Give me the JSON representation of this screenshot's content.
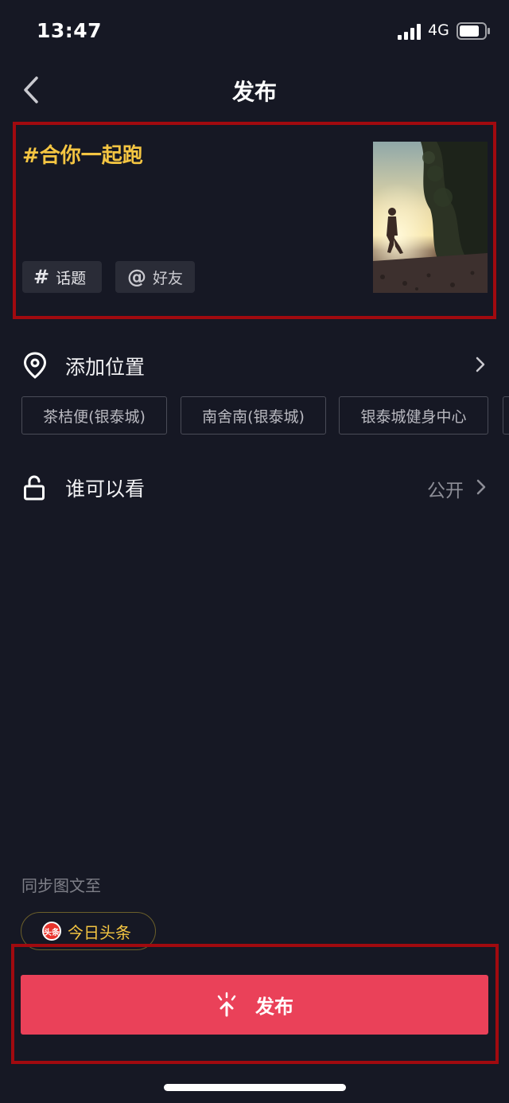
{
  "status_bar": {
    "time": "13:47",
    "network": "4G"
  },
  "nav": {
    "title": "发布"
  },
  "post": {
    "caption": "#合你一起跑",
    "topic_button": {
      "symbol": "#",
      "label": "话题"
    },
    "friend_button": {
      "symbol": "@",
      "label": "好友"
    }
  },
  "location": {
    "label": "添加位置",
    "suggestions": [
      "茶桔便(银泰城)",
      "南舍南(银泰城)",
      "银泰城健身中心",
      ""
    ]
  },
  "privacy": {
    "label": "谁可以看",
    "value": "公开"
  },
  "sync": {
    "label": "同步图文至",
    "target": "今日头条",
    "logo_text": "头条"
  },
  "publish": {
    "label": "发布"
  },
  "colors": {
    "background": "#161824",
    "caption": "#f4c542",
    "publish_button": "#ea4159",
    "highlight_frame": "#a10a0f"
  }
}
